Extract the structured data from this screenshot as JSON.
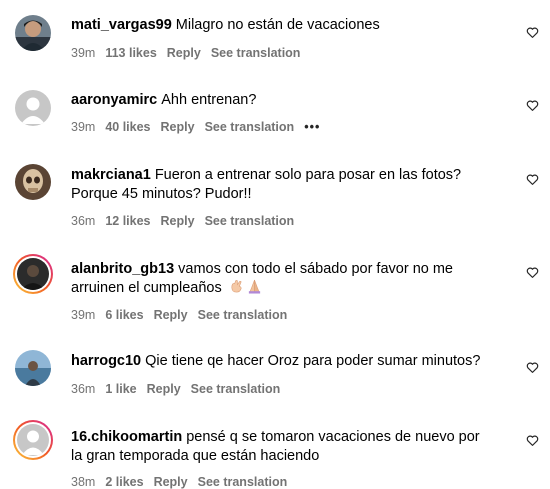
{
  "comments": [
    {
      "username": "mati_vargas99",
      "text": "Milagro no están de vacaciones",
      "time": "39m",
      "likes": "113 likes",
      "reply": "Reply",
      "translate": "See translation",
      "avatar": "photo-man-icon"
    },
    {
      "username": "aaronyamirc",
      "text": "Ahh entrenan?",
      "time": "39m",
      "likes": "40 likes",
      "reply": "Reply",
      "translate": "See translation",
      "more": "•••",
      "avatar": "default-avatar-icon"
    },
    {
      "username": "makrciana1",
      "text": "Fueron a entrenar solo para posar en las fotos?",
      "text2": "Porque 45 minutos? Pudor!!",
      "time": "36m",
      "likes": "12 likes",
      "reply": "Reply",
      "translate": "See translation",
      "avatar": "photo-skull-icon"
    },
    {
      "username": "alanbrito_gb13",
      "text": "vamos con todo el sábado por favor no me",
      "text2": "arruinen el cumpleaños",
      "emojis": [
        "hand-gesture-emoji",
        "praying-hands-emoji"
      ],
      "time": "39m",
      "likes": "6 likes",
      "reply": "Reply",
      "translate": "See translation",
      "avatar": "photo-dark-icon"
    },
    {
      "username": "harrogc10",
      "text": "Qie tiene qe hacer Oroz para poder sumar minutos?",
      "time": "36m",
      "likes": "1 like",
      "reply": "Reply",
      "translate": "See translation",
      "avatar": "photo-landscape-icon"
    },
    {
      "username": "16.chikoomartin",
      "text": "pensé q se tomaron vacaciones de nuevo por",
      "text2": "la gran temporada que están haciendo",
      "time": "38m",
      "likes": "2 likes",
      "reply": "Reply",
      "translate": "See translation",
      "avatar": "default-avatar-icon"
    }
  ],
  "colors": {
    "meta_text": "#737373",
    "story_ring": "#d6249f",
    "default_avatar_bg": "#c7c7c7"
  }
}
